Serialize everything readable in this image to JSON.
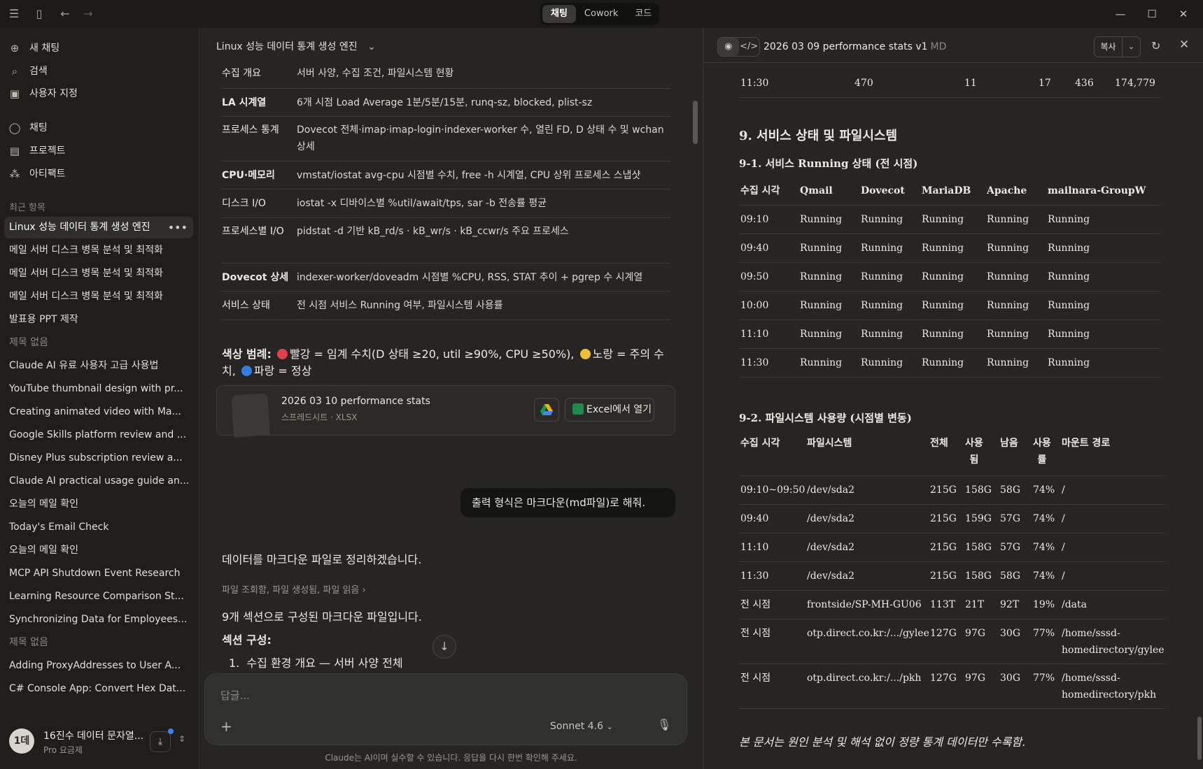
{
  "titlebar": {
    "mode_tabs": [
      "채팅",
      "Cowork",
      "코드"
    ]
  },
  "sidebar": {
    "nav": [
      {
        "label": "새 채팅",
        "icon": "plus-icon"
      },
      {
        "label": "검색",
        "icon": "search-icon"
      },
      {
        "label": "사용자 지정",
        "icon": "briefcase-icon"
      },
      {
        "label": "채팅",
        "icon": "chat-icon"
      },
      {
        "label": "프로젝트",
        "icon": "folder-icon"
      },
      {
        "label": "아티팩트",
        "icon": "artifacts-icon"
      }
    ],
    "recent_label": "최근 항목",
    "recents": [
      "Linux 성능 데이터 통계 생성 엔진",
      "메일 서버 디스크 병목 분석 및 최적화",
      "메일 서버 디스크 병목 분석 및 최적화",
      "메일 서버 디스크 병목 분석 및 최적화",
      "발표용 PPT 제작",
      "제목 없음",
      "Claude AI 유료 사용자 고급 사용법",
      "YouTube thumbnail design with pr...",
      "Creating animated video with Ma...",
      "Google Skills platform review and ...",
      "Disney Plus subscription review a...",
      "Claude AI practical usage guide an...",
      "오늘의 메일 확인",
      "Today's Email Check",
      "오늘의 메일 확인",
      "MCP API Shutdown Event Research",
      "Learning Resource Comparison St...",
      "Synchronizing Data for Employees...",
      "제목 없음",
      "Adding ProxyAddresses to User A...",
      "C# Console App: Convert Hex Dat..."
    ],
    "user": {
      "initial": "1데",
      "name": "16진수 데이터 문자열...",
      "plan": "Pro 요금제"
    }
  },
  "chat": {
    "title": "Linux 성능 데이터 통계 생성 엔진",
    "table": [
      {
        "k": "수집 개요",
        "v": "서버 사양, 수집 조건, 파일시스템 현황"
      },
      {
        "k": "LA 시계열",
        "v": "6개 시점 Load Average 1분/5분/15분, runq-sz, blocked, plist-sz"
      },
      {
        "k": "프로세스 통계",
        "v": "Dovecot 전체·imap·imap-login·indexer-worker 수, 열린 FD, D 상태 수 및 wchan 상세"
      },
      {
        "k": "CPU·메모리",
        "v": "vmstat/iostat avg-cpu 시점별 수치, free -h 시계열, CPU 상위 프로세스 스냅샷"
      },
      {
        "k": "디스크 I/O",
        "v": "iostat -x 디바이스별 %util/await/tps, sar -b 전송률 평균"
      },
      {
        "k": "프로세스별 I/O",
        "v": "pidstat -d 기반 kB_rd/s · kB_wr/s · kB_ccwr/s 주요 프로세스"
      },
      {
        "k": "Dovecot 상세",
        "v": "indexer-worker/doveadm 시점별 %CPU, RSS, STAT 추이 + pgrep 수 시계열"
      },
      {
        "k": "서비스 상태",
        "v": "전 시점 서비스 Running 여부, 파일시스템 사용률"
      }
    ],
    "legend": {
      "prefix": "색상 범례:",
      "red": "빨강 = 임계 수치(D 상태 ≥20, util ≥90%, CPU ≥50%),",
      "yellow": "노랑 = 주의 수치,",
      "blue": "파랑 = 정상"
    },
    "file": {
      "name": "2026 03 10 performance stats",
      "type": "스프레드시트 · XLSX",
      "open_label": "Excel에서 열기"
    },
    "user_message": "출력 형식은 마크다운(md파일)로 해줘.",
    "reply1": "데이터를 마크다운 파일로 정리하겠습니다.",
    "tool_line": "파일 조회함, 파일 생성됨, 파일 읽음",
    "reply2": "9개 섹션으로 구성된 마크다운 파일입니다.",
    "reply3": "섹션 구성:",
    "list_item_1": "수집 환경 개요 — 서버 사양 전체",
    "composer_placeholder": "답글...",
    "model": "Sonnet 4.6",
    "disclaimer": "Claude는 AI이며 실수할 수 있습니다. 응답을 다시 한번 확인해 주세요."
  },
  "doc": {
    "title": "2026 03 09 performance stats v1",
    "ext": "MD",
    "copy_label": "복사",
    "top_row": [
      "11:30",
      "470",
      "11",
      "17",
      "436",
      "174,779"
    ],
    "h9": "9. 서비스 상태 및 파일시스템",
    "h91": "9-1. 서비스 Running 상태 (전 시점)",
    "svc_headers": [
      "수집 시각",
      "Qmail",
      "Dovecot",
      "MariaDB",
      "Apache",
      "mailnara-GroupW"
    ],
    "svc_rows": [
      [
        "09:10",
        "Running",
        "Running",
        "Running",
        "Running",
        "Running"
      ],
      [
        "09:40",
        "Running",
        "Running",
        "Running",
        "Running",
        "Running"
      ],
      [
        "09:50",
        "Running",
        "Running",
        "Running",
        "Running",
        "Running"
      ],
      [
        "10:00",
        "Running",
        "Running",
        "Running",
        "Running",
        "Running"
      ],
      [
        "11:10",
        "Running",
        "Running",
        "Running",
        "Running",
        "Running"
      ],
      [
        "11:30",
        "Running",
        "Running",
        "Running",
        "Running",
        "Running"
      ]
    ],
    "h92": "9-2. 파일시스템 사용량 (시점별 변동)",
    "fs_headers": [
      "수집 시각",
      "파일시스템",
      "전체",
      "사용\n됨",
      "남음",
      "사용\n률",
      "마운트 경로"
    ],
    "fs_rows": [
      [
        "09:10~09:50",
        "/dev/sda2",
        "215G",
        "158G",
        "58G",
        "74%",
        "/"
      ],
      [
        "09:40",
        "/dev/sda2",
        "215G",
        "159G",
        "57G",
        "74%",
        "/"
      ],
      [
        "11:10",
        "/dev/sda2",
        "215G",
        "158G",
        "57G",
        "74%",
        "/"
      ],
      [
        "11:30",
        "/dev/sda2",
        "215G",
        "158G",
        "58G",
        "74%",
        "/"
      ],
      [
        "전 시점",
        "frontside/SP-MH-GU06",
        "113T",
        "21T",
        "92T",
        "19%",
        "/data"
      ],
      [
        "전 시점",
        "otp.direct.co.kr:/.../gylee",
        "127G",
        "97G",
        "30G",
        "77%",
        "/home/sssd-\nhomedirectory/gylee"
      ],
      [
        "전 시점",
        "otp.direct.co.kr:/.../pkh",
        "127G",
        "97G",
        "30G",
        "77%",
        "/home/sssd-\nhomedirectory/pkh"
      ]
    ],
    "footer": "본 문서는 원인 분석 및 해석 없이 정량 통계 데이터만 수록함."
  },
  "colors": {
    "red": "#e0404a",
    "yellow": "#f0c02e",
    "blue": "#2f7fe0"
  }
}
